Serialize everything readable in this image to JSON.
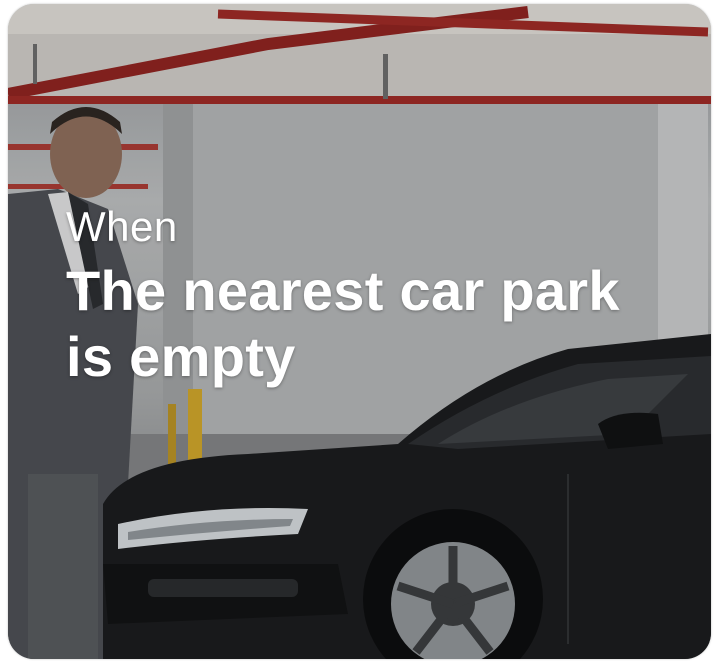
{
  "card": {
    "eyebrow": "When",
    "headline": "The nearest car park is empty"
  }
}
